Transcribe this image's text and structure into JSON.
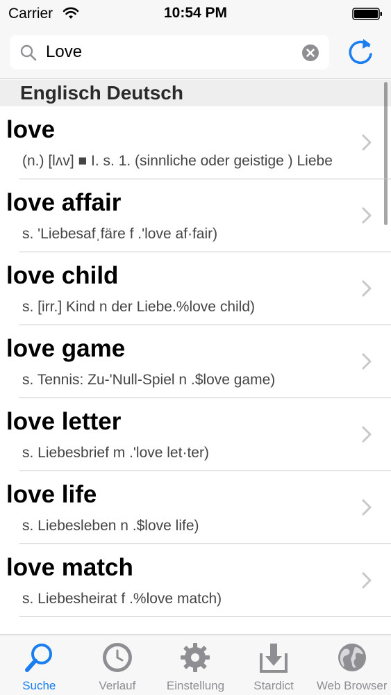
{
  "status_bar": {
    "carrier": "Carrier",
    "time": "10:54 PM"
  },
  "search": {
    "value": "Love",
    "placeholder": ""
  },
  "section": {
    "title": "Englisch Deutsch"
  },
  "results": [
    {
      "word": "love",
      "definition": "(n.) [lʌv] ■ I. s.  1. (sinnliche oder geistige ) Liebe"
    },
    {
      "word": "love affair",
      "definition": "s. 'Liebesafˌfäre f .'love af·fair)"
    },
    {
      "word": "love child",
      "definition": "s. [irr.] Kind n der Liebe.%love child)"
    },
    {
      "word": "love game",
      "definition": "s.  Tennis: Zu-'Null-Spiel n .$love game)"
    },
    {
      "word": "love letter",
      "definition": "s. Liebesbrief m .'love let·ter)"
    },
    {
      "word": "love life",
      "definition": "s. Liebesleben n .$love life)"
    },
    {
      "word": "love match",
      "definition": "s. Liebesheirat f .%love match)"
    },
    {
      "word": "",
      "definition": ""
    }
  ],
  "tabs": [
    {
      "label": "Suche",
      "icon": "search-icon",
      "active": true
    },
    {
      "label": "Verlauf",
      "icon": "clock-icon",
      "active": false
    },
    {
      "label": "Einstellung",
      "icon": "gear-icon",
      "active": false
    },
    {
      "label": "Stardict",
      "icon": "download-icon",
      "active": false
    },
    {
      "label": "Web Browser",
      "icon": "globe-icon",
      "active": false
    }
  ],
  "colors": {
    "accent": "#1a7ef0",
    "inactive_tab": "#8e8e93",
    "background_bar": "#f7f7f7",
    "section_bg": "#eeeeef"
  }
}
